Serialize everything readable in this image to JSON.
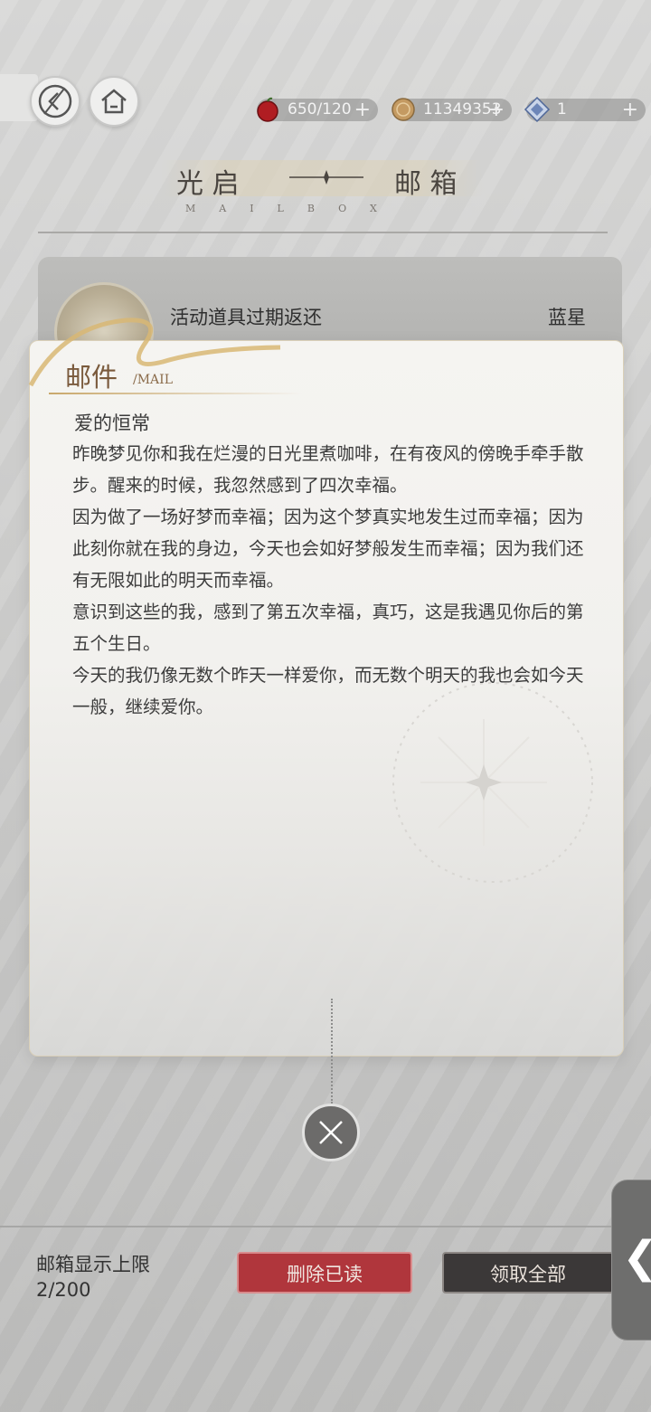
{
  "header": {
    "back_icon": "back-arrow-icon",
    "home_icon": "home-icon",
    "resources": [
      {
        "icon": "apple-icon",
        "value": "650/120",
        "plus": "+"
      },
      {
        "icon": "coin-icon",
        "value": "11349353",
        "plus": "+"
      },
      {
        "icon": "star-crystal-icon",
        "value": "1",
        "plus": "+"
      }
    ]
  },
  "title": {
    "left": "光  启",
    "right": "邮  箱",
    "subtitle": "MAILBOX"
  },
  "mail_item": {
    "title": "活动道具过期返还",
    "sender": "蓝星"
  },
  "letter": {
    "label": "邮件",
    "label_en": "/MAIL",
    "title": "爱的恒常",
    "body": "昨晚梦见你和我在烂漫的日光里煮咖啡，在有夜风的傍晚手牵手散步。醒来的时候，我忽然感到了四次幸福。\n因为做了一场好梦而幸福；因为这个梦真实地发生过而幸福；因为此刻你就在我的身边，今天也会如好梦般发生而幸福；因为我们还有无限如此的明天而幸福。\n意识到这些的我，感到了第五次幸福，真巧，这是我遇见你后的第五个生日。\n今天的我仍像无数个昨天一样爱你，而无数个明天的我也会如今天一般，继续爱你。"
  },
  "footer": {
    "limit_label": "邮箱显示上限",
    "limit_count": "2/200",
    "delete_read": "删除已读",
    "claim_all": "领取全部",
    "side_arrow": "❮"
  },
  "colors": {
    "delete_button": "#b0363c",
    "claim_button": "#3b3838",
    "gold_accent": "#c9a86b"
  }
}
